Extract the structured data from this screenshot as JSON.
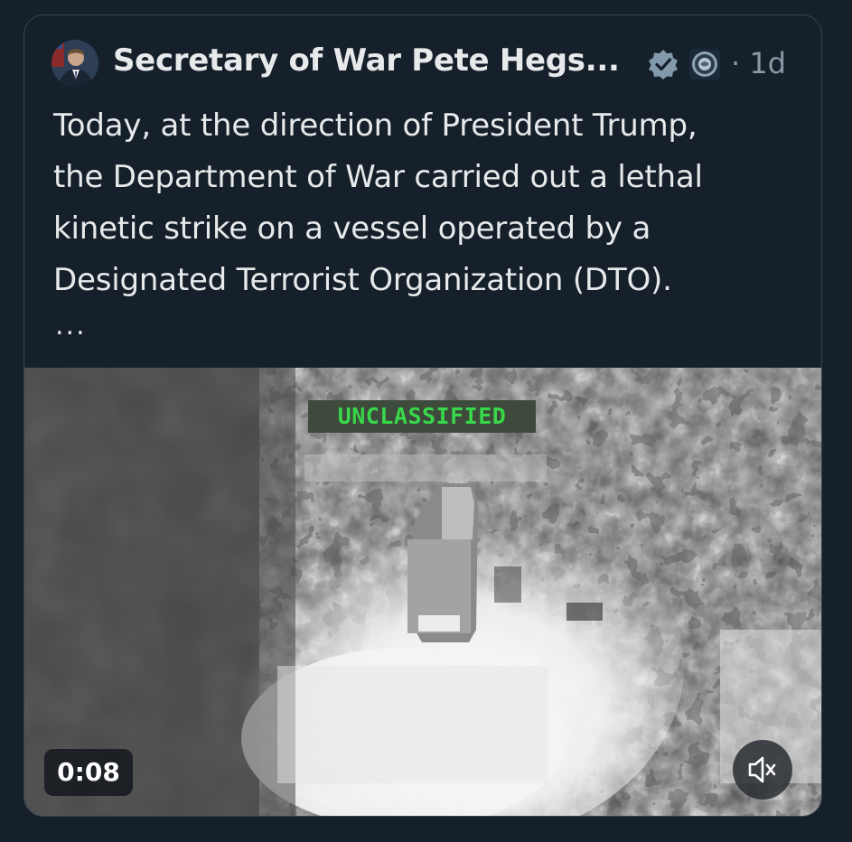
{
  "post": {
    "author_name": "Secretary of War Pete Hegs...",
    "time_separator": "·",
    "time_ago": "1d",
    "text_lines": [
      "Today, at the direction of President Trump,",
      "the Department of War carried out a lethal",
      "kinetic strike on a vessel operated by a",
      "Designated Terrorist Organization (DTO)."
    ],
    "truncation": "..."
  },
  "video": {
    "overlay_label": "UNCLASSIFIED",
    "duration": "0:08"
  },
  "icons": {
    "verified": "verified-badge-icon",
    "affiliation": "affiliation-seal-icon",
    "mute": "speaker-muted-icon"
  },
  "colors": {
    "background": "#15202b",
    "border": "#38444d",
    "text_primary": "#e7e9ea",
    "text_secondary": "#8b98a5",
    "verified_badge": "#829aab",
    "overlay_text": "#38d84a"
  }
}
